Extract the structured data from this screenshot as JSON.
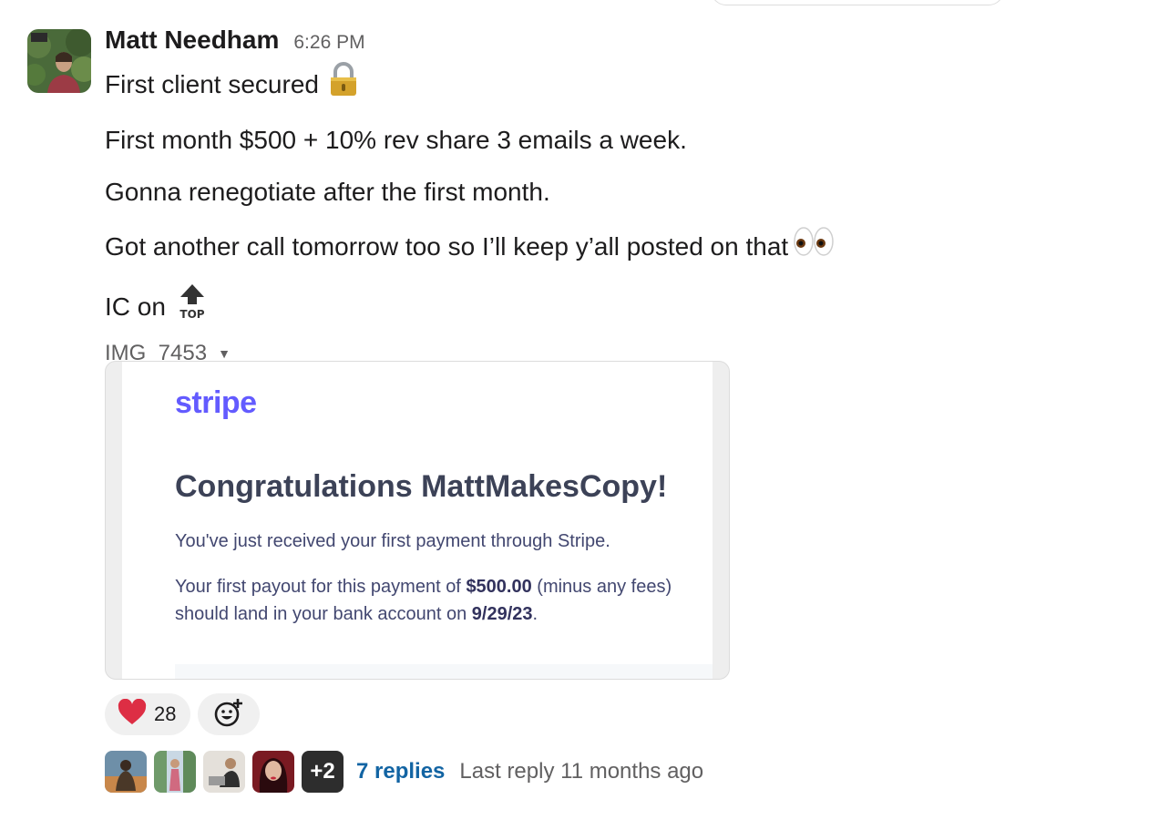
{
  "message": {
    "author": "Matt Needham",
    "timestamp": "6:26 PM",
    "lines": [
      "First client secured",
      "First month $500 + 10% rev share 3 emails a week.",
      "Gonna renegotiate after the first month.",
      "Got another call tomorrow too so I’ll keep y’all posted on that",
      "IC on"
    ],
    "emoji_icons": [
      "lock-icon",
      "eyes-icon",
      "top-arrow-icon"
    ]
  },
  "file": {
    "name": "IMG_7453",
    "caret": "▼"
  },
  "attachment": {
    "logo": "stripe",
    "title": "Congratulations MattMakesCopy!",
    "para1": "You've just received your first payment through Stripe.",
    "para2_a": "Your first payout for this payment of ",
    "para2_amount": "$500.00",
    "para2_b": " (minus any fees) should land in your bank account on ",
    "para2_date": "9/29/23",
    "para2_c": "."
  },
  "reactions": [
    {
      "icon": "heart-icon",
      "count": "28"
    }
  ],
  "add_reaction_icon": "add-reaction-icon",
  "thread": {
    "more_count": "+2",
    "replies": "7 replies",
    "last_reply": "Last reply 11 months ago"
  },
  "colors": {
    "accent_link": "#1264a3",
    "stripe_brand": "#635bff",
    "heart": "#dd2e44"
  }
}
